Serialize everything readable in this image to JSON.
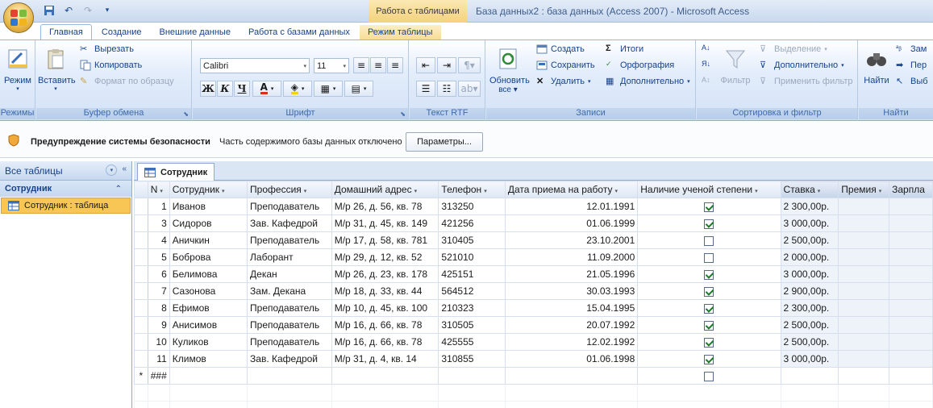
{
  "app": {
    "context_tab_title": "Работа с таблицами",
    "window_title": "База данных2 : база данных (Access 2007) - Microsoft Access"
  },
  "ribbon_tabs": [
    {
      "label": "Главная",
      "active": true
    },
    {
      "label": "Создание"
    },
    {
      "label": "Внешние данные"
    },
    {
      "label": "Работа с базами данных"
    },
    {
      "label": "Режим таблицы",
      "context": true
    }
  ],
  "ribbon": {
    "groups": {
      "views": "Режимы",
      "clipboard": "Буфер обмена",
      "font": "Шрифт",
      "rtf": "Текст RTF",
      "records": "Записи",
      "sort_filter": "Сортировка и фильтр",
      "find": "Найти"
    },
    "view_button": "Режим",
    "paste_button": "Вставить",
    "cut": "Вырезать",
    "copy": "Копировать",
    "format_painter": "Формат по образцу",
    "font_name": "Calibri",
    "font_size": "11",
    "bold": "Ж",
    "italic": "К",
    "underline": "Ч",
    "refresh_button": [
      "Обновить",
      "все"
    ],
    "new_record": "Создать",
    "save_record": "Сохранить",
    "delete_record": "Удалить",
    "totals": "Итоги",
    "spelling": "Орфография",
    "more_records": "Дополнительно",
    "filter_button": "Фильтр",
    "selection": "Выделение",
    "advanced": "Дополнительно",
    "toggle_filter": "Применить фильтр",
    "find_button": "Найти",
    "replace": "Зам",
    "goto": "Пер",
    "select": "Выб"
  },
  "security_bar": {
    "title": "Предупреждение системы безопасности",
    "message": "Часть содержимого базы данных отключено",
    "options_button": "Параметры..."
  },
  "nav_pane": {
    "header": "Все таблицы",
    "group": "Сотрудник",
    "item": "Сотрудник : таблица"
  },
  "document_tab": "Сотрудник",
  "table": {
    "columns": [
      {
        "label": "N",
        "dd": true
      },
      {
        "label": "Сотрудник",
        "dd": true
      },
      {
        "label": "Профессия",
        "dd": true
      },
      {
        "label": "Домашний адрес",
        "dd": true
      },
      {
        "label": "Телефон",
        "dd": true
      },
      {
        "label": "Дата приема на работу",
        "dd": true
      },
      {
        "label": "Наличие ученой степени",
        "dd": true
      },
      {
        "label": "Ставка",
        "dd": true
      },
      {
        "label": "Премия",
        "dd": true
      },
      {
        "label": "Зарпла",
        "dd": false
      }
    ],
    "rows": [
      {
        "n": "1",
        "name": "Иванов",
        "prof": "Преподаватель",
        "addr": "М/р 26, д. 56, кв. 78",
        "phone": "313250",
        "date": "12.01.1991",
        "degree": true,
        "rate": "2 300,00р."
      },
      {
        "n": "3",
        "name": "Сидоров",
        "prof": "Зав. Кафедрой",
        "addr": "М/р 31, д. 45, кв. 149",
        "phone": "421256",
        "date": "01.06.1999",
        "degree": true,
        "rate": "3 000,00р."
      },
      {
        "n": "4",
        "name": "Аничкин",
        "prof": "Преподаватель",
        "addr": "М/р 17, д. 58, кв. 781",
        "phone": "310405",
        "date": "23.10.2001",
        "degree": false,
        "rate": "2 500,00р."
      },
      {
        "n": "5",
        "name": "Боброва",
        "prof": "Лаборант",
        "addr": "М/р 29, д. 12, кв. 52",
        "phone": "521010",
        "date": "11.09.2000",
        "degree": false,
        "rate": "2 000,00р."
      },
      {
        "n": "6",
        "name": "Белимова",
        "prof": "Декан",
        "addr": "М/р 26, д. 23, кв. 178",
        "phone": "425151",
        "date": "21.05.1996",
        "degree": true,
        "rate": "3 000,00р."
      },
      {
        "n": "7",
        "name": "Сазонова",
        "prof": "Зам. Декана",
        "addr": "М/р 18, д. 33, кв. 44",
        "phone": "564512",
        "date": "30.03.1993",
        "degree": true,
        "rate": "2 900,00р."
      },
      {
        "n": "8",
        "name": "Ефимов",
        "prof": "Преподаватель",
        "addr": "М/р 10, д. 45, кв. 100",
        "phone": "210323",
        "date": "15.04.1995",
        "degree": true,
        "rate": "2 300,00р."
      },
      {
        "n": "9",
        "name": "Анисимов",
        "prof": "Преподаватель",
        "addr": "М/р 16, д. 66, кв. 78",
        "phone": "310505",
        "date": "20.07.1992",
        "degree": true,
        "rate": "2 500,00р."
      },
      {
        "n": "10",
        "name": "Куликов",
        "prof": "Преподаватель",
        "addr": "М/р 16, д. 66, кв. 78",
        "phone": "425555",
        "date": "12.02.1992",
        "degree": true,
        "rate": "2 500,00р."
      },
      {
        "n": "11",
        "name": "Климов",
        "prof": "Зав. Кафедрой",
        "addr": "М/р 31, д. 4, кв. 14",
        "phone": "310855",
        "date": "01.06.1998",
        "degree": true,
        "rate": "3 000,00р."
      }
    ],
    "new_row_marker": "*",
    "new_row_n": "###"
  }
}
